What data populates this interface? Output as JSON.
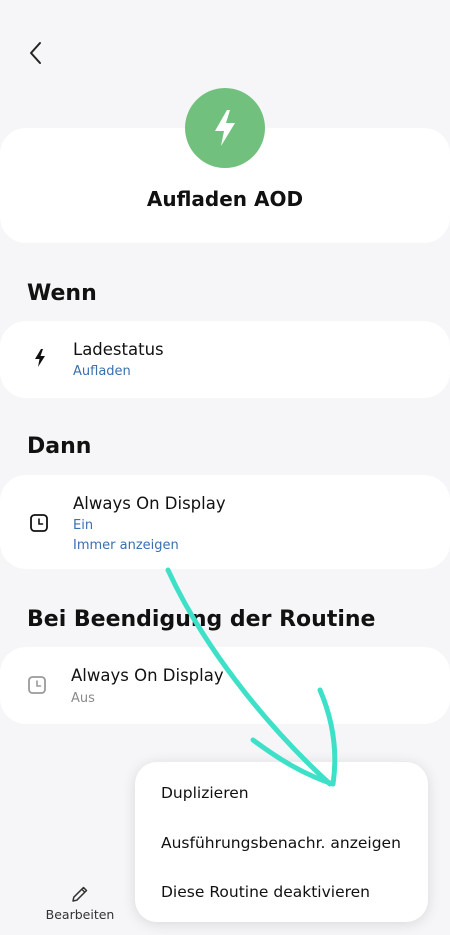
{
  "header": {
    "back_icon": "chevron-left-icon"
  },
  "routine": {
    "title": "Aufladen AOD",
    "icon": "lightning-bolt-icon",
    "icon_color": "#72c07e"
  },
  "sections": {
    "when": {
      "title": "Wenn",
      "item": {
        "icon": "lightning-bolt-icon",
        "title": "Ladestatus",
        "subtitle": "Aufladen"
      }
    },
    "then": {
      "title": "Dann",
      "item": {
        "icon": "clock-icon",
        "title": "Always On Display",
        "subtitle_1": "Ein",
        "subtitle_2": "Immer anzeigen"
      }
    },
    "on_end": {
      "title": "Bei Beendigung der Routine",
      "item": {
        "icon": "clock-icon",
        "title": "Always On Display",
        "subtitle": "Aus"
      }
    }
  },
  "menu": {
    "items": [
      {
        "label": "Duplizieren"
      },
      {
        "label": "Ausführungsbenachr. anzeigen"
      },
      {
        "label": "Diese Routine deaktivieren"
      }
    ]
  },
  "bottom_bar": {
    "edit_label": "Bearbeiten",
    "edit_icon": "pencil-icon"
  },
  "annotation": {
    "arrow_color": "#3fe0c8"
  },
  "colors": {
    "link_blue": "#3a6fb0",
    "background": "#f6f6f8"
  }
}
